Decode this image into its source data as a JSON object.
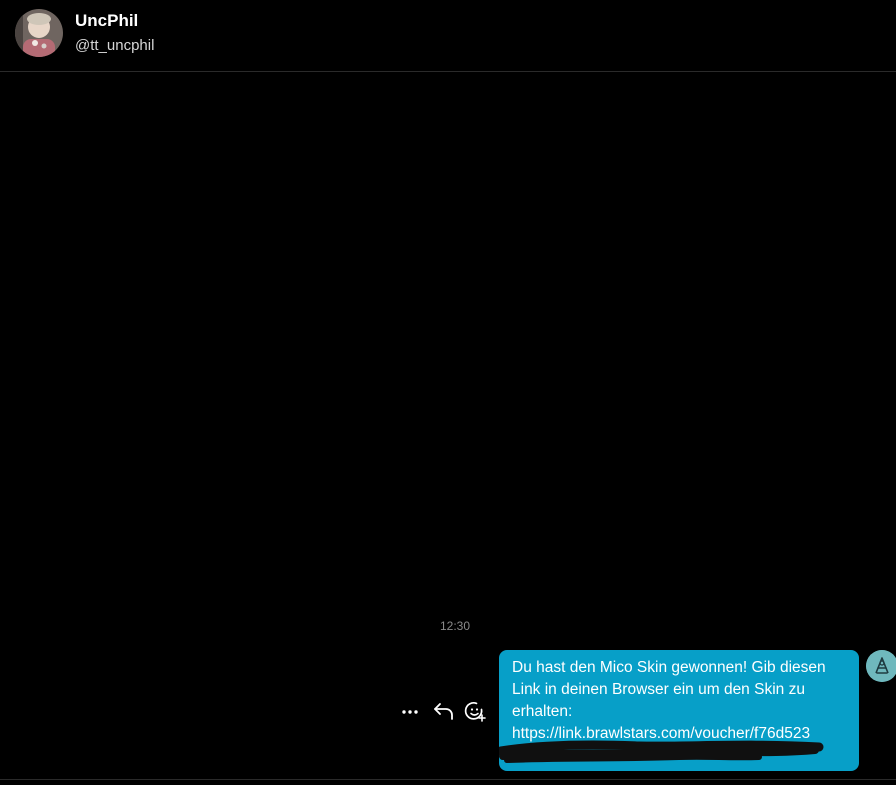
{
  "header": {
    "name": "UncPhil",
    "handle": "@tt_uncphil",
    "avatar_icon": "user-avatar"
  },
  "conversation": {
    "timestamp": "12:30",
    "message": {
      "text": "Du hast den Mico Skin gewonnen! Gib diesen Link in deinen Browser ein um den Skin zu erhalten:",
      "link": "https://link.brawlstars.com/voucher/f76d523",
      "bubble_color": "#079fc8",
      "redaction_icon": "redaction-scribble"
    },
    "actions": {
      "more_icon": "more-dots-icon",
      "reply_icon": "reply-arrow-icon",
      "react_icon": "add-reaction-icon"
    },
    "self_avatar_icon": "self-avatar"
  },
  "colors": {
    "background": "#000000",
    "divider": "#2a2a2a",
    "timestamp": "#8a8a8a",
    "bubble": "#079fc8"
  }
}
